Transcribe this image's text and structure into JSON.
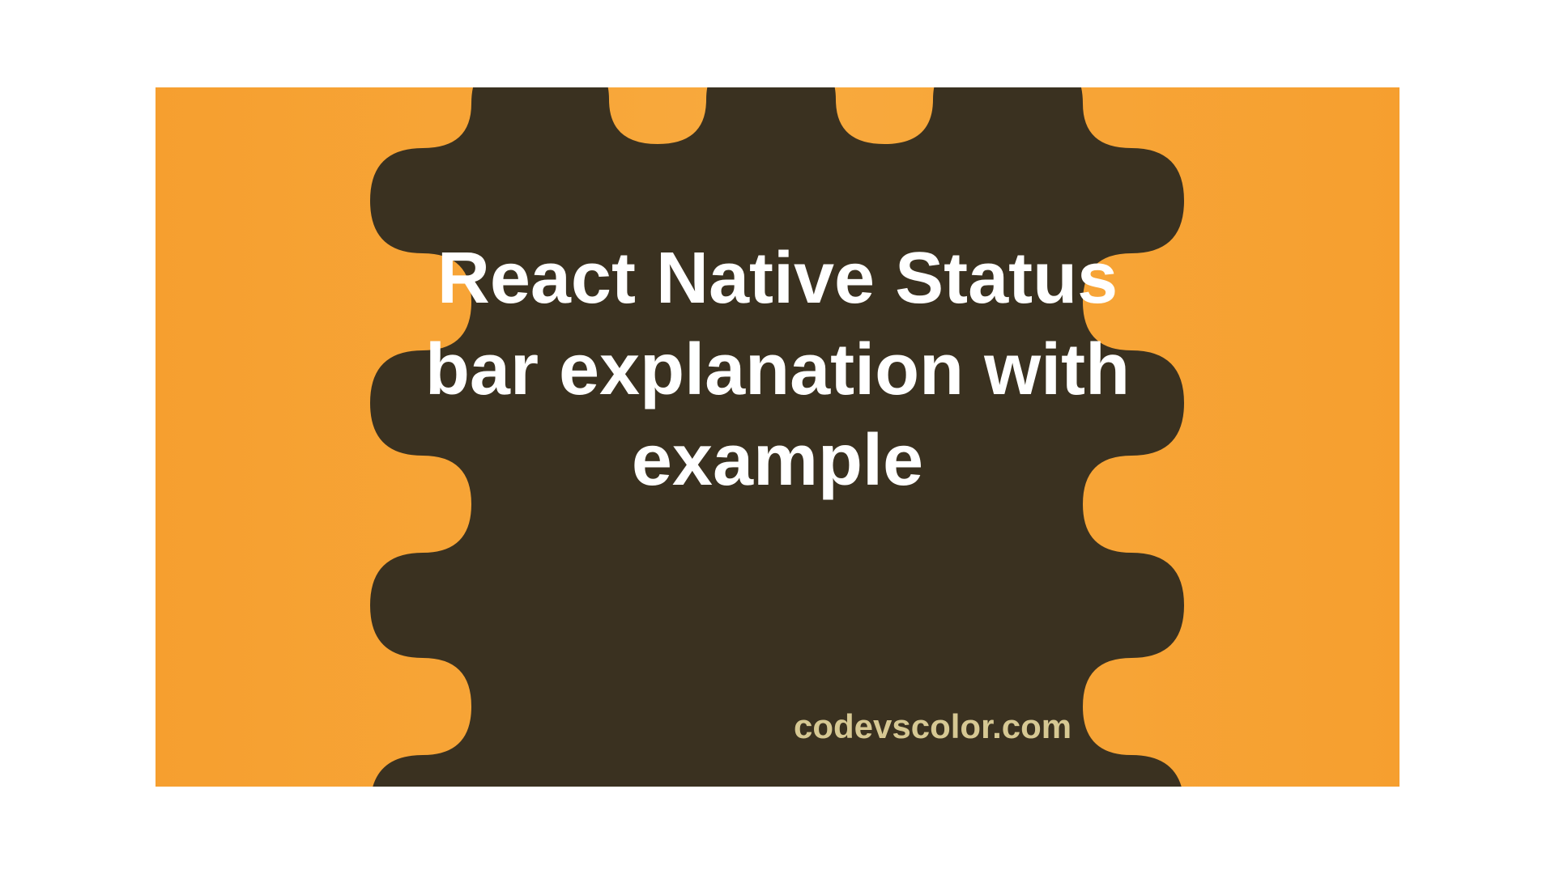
{
  "title": "React Native Status bar explanation with example",
  "credit": "codevscolor.com",
  "colors": {
    "background_orange": "#f7a636",
    "blob_dark": "#3a3120",
    "text_white": "#ffffff",
    "credit_tan": "#d6c893"
  }
}
